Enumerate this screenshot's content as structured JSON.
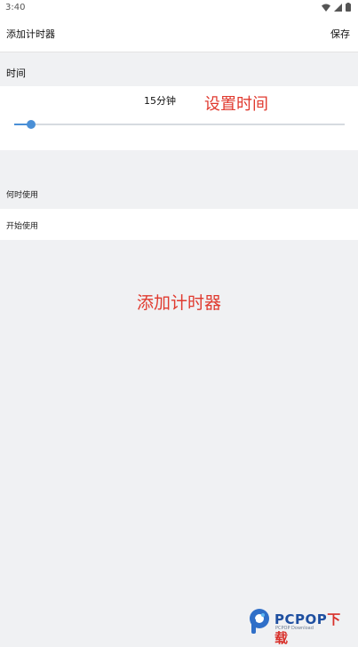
{
  "status_bar": {
    "time": "3:40"
  },
  "app_bar": {
    "title": "添加计时器",
    "save_label": "保存"
  },
  "time_section": {
    "label": "时间",
    "duration_text": "15分钟",
    "slider_fraction": 0.05,
    "annotation": "设置时间"
  },
  "when_section": {
    "label": "何时使用"
  },
  "start_row": {
    "label": "开始使用"
  },
  "annotation_add": "添加计时器",
  "watermark": {
    "brand": "PCPOP",
    "brand_suffix": "下载",
    "subtext": "PCPOP Download"
  },
  "colors": {
    "accent": "#4a8fd6",
    "annotation": "#e03a2f",
    "background": "#f0f1f3"
  }
}
